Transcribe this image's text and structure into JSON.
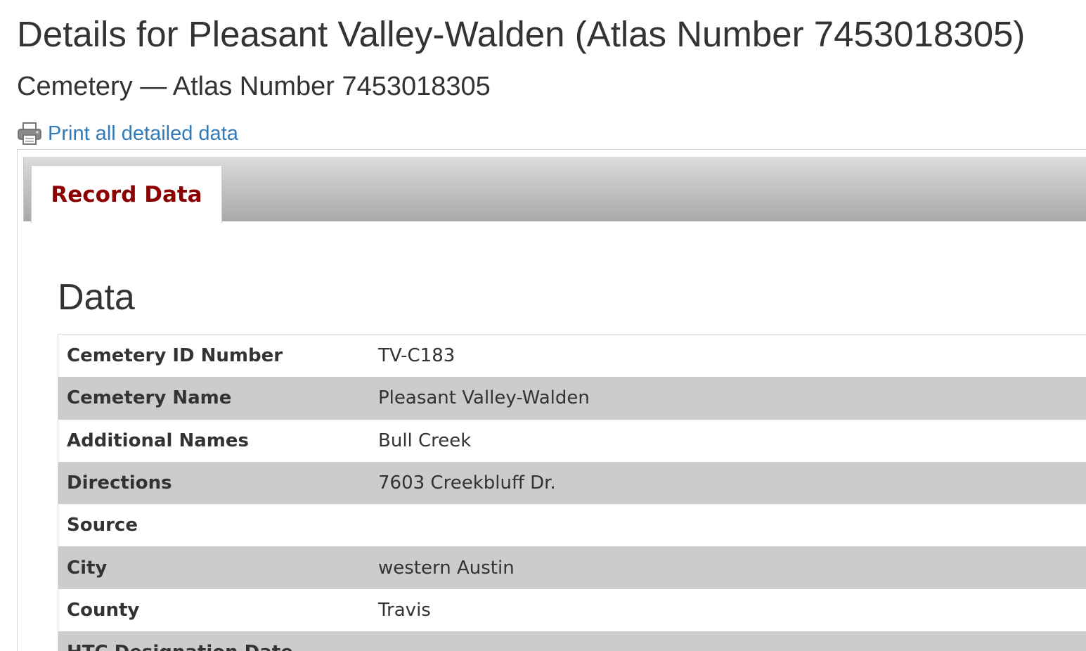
{
  "header": {
    "title": "Details for Pleasant Valley-Walden (Atlas Number 7453018305)",
    "subtitle": "Cemetery — Atlas Number 7453018305",
    "print_link": "Print all detailed data",
    "print_icon": "printer-icon"
  },
  "tabs": [
    {
      "label": "Record Data",
      "active": true
    }
  ],
  "section": {
    "heading": "Data"
  },
  "records": [
    {
      "label": "Cemetery ID Number",
      "value": "TV-C183"
    },
    {
      "label": "Cemetery Name",
      "value": "Pleasant Valley-Walden"
    },
    {
      "label": "Additional Names",
      "value": "Bull Creek"
    },
    {
      "label": "Directions",
      "value": "7603 Creekbluff Dr."
    },
    {
      "label": "Source",
      "value": ""
    },
    {
      "label": "City",
      "value": "western Austin"
    },
    {
      "label": "County",
      "value": "Travis"
    },
    {
      "label": "HTC Designation Date",
      "value": ""
    }
  ],
  "colors": {
    "link": "#337ab7",
    "tab_label": "#8b0000",
    "stripe": "#cccccc",
    "text": "#333333"
  }
}
